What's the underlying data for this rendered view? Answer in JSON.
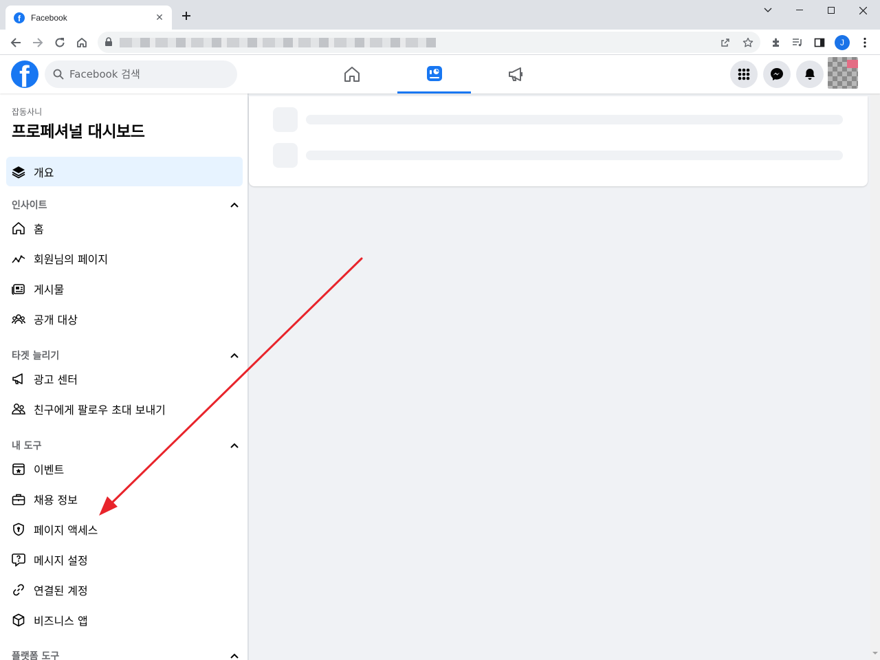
{
  "browser": {
    "tab_title": "Facebook",
    "tab_close": "✕",
    "new_tab": "+",
    "profile_initial": "J"
  },
  "header": {
    "search_placeholder": "Facebook 검색",
    "logo_letter": "f",
    "nav_tabs": [
      "home-icon",
      "dashboard-icon",
      "megaphone-icon"
    ],
    "active_tab": 1,
    "accent": "#1877f2"
  },
  "sidebar": {
    "subtitle": "잡동사니",
    "title": "프로페셔널 대시보드",
    "overview": "개요",
    "sections": [
      {
        "label": "인사이트",
        "items": [
          "홈",
          "회원님의 페이지",
          "게시물",
          "공개 대상"
        ]
      },
      {
        "label": "타겟 늘리기",
        "items": [
          "광고 센터",
          "친구에게 팔로우 초대 보내기"
        ]
      },
      {
        "label": "내 도구",
        "items": [
          "이벤트",
          "채용 정보",
          "페이지 액세스",
          "메시지 설정",
          "연결된 계정",
          "비즈니스 앱"
        ]
      },
      {
        "label": "플랫폼 도구",
        "items": []
      }
    ]
  },
  "annotation": {
    "arrow_color": "#e8242b",
    "points_to": "페이지 액세스"
  }
}
